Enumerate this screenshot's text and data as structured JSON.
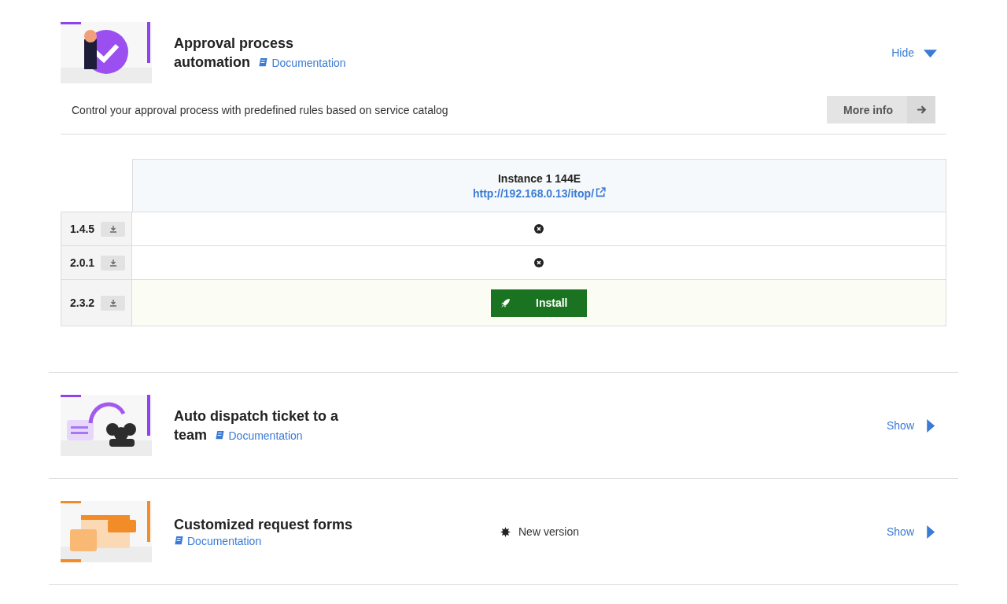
{
  "extensions": [
    {
      "title": "Approval process automation",
      "doc_link": "Documentation",
      "toggle": "Hide",
      "expanded": true,
      "description": "Control your approval process with predefined rules based on service catalog",
      "more_info": "More info",
      "table": {
        "instance": "Instance 1 144E",
        "url": "http://192.168.0.13/itop/",
        "rows": [
          {
            "version": "1.4.5",
            "kind": "unavailable"
          },
          {
            "version": "2.0.1",
            "kind": "unavailable"
          },
          {
            "version": "2.3.2",
            "kind": "install",
            "action": "Install"
          }
        ]
      }
    },
    {
      "title": "Auto dispatch ticket to a team",
      "doc_link": "Documentation",
      "toggle": "Show",
      "expanded": false
    },
    {
      "title": "Customized request forms",
      "doc_link": "Documentation",
      "toggle": "Show",
      "expanded": false,
      "badge": "New version"
    }
  ]
}
